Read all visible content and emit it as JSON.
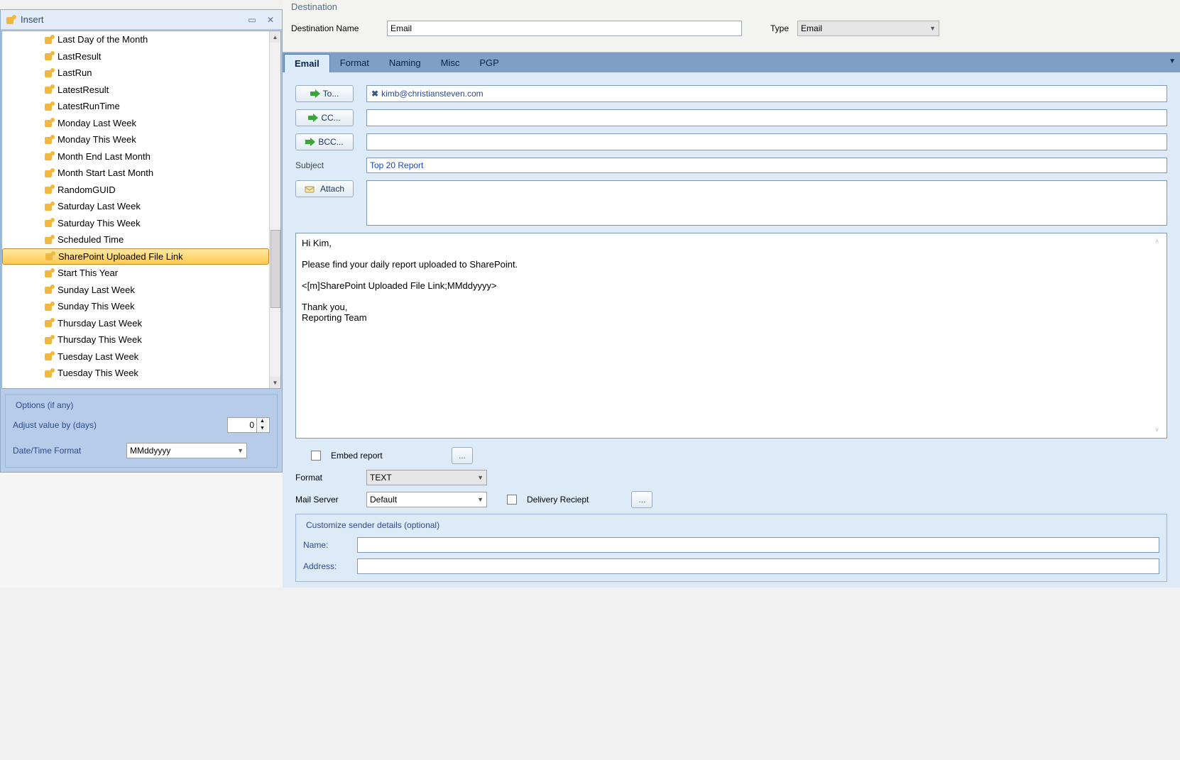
{
  "insert": {
    "title": "Insert",
    "items": [
      "Last Day of the Month",
      "LastResult",
      "LastRun",
      "LatestResult",
      "LatestRunTime",
      "Monday Last Week",
      "Monday This Week",
      "Month End Last Month",
      "Month Start Last Month",
      "RandomGUID",
      "Saturday Last Week",
      "Saturday This Week",
      "Scheduled Time",
      "SharePoint Uploaded File Link",
      "Start This Year",
      "Sunday Last Week",
      "Sunday This Week",
      "Thursday Last Week",
      "Thursday This Week",
      "Tuesday Last Week",
      "Tuesday This Week"
    ],
    "selected_index": 13,
    "options_title": "Options (if any)",
    "adjust_label": "Adjust value by (days)",
    "adjust_value": "0",
    "format_label": "Date/Time Format",
    "format_value": "MMddyyyy"
  },
  "destination": {
    "group_title": "Destination",
    "name_label": "Destination Name",
    "name_value": "Email",
    "type_label": "Type",
    "type_value": "Email",
    "tabs": [
      "Email",
      "Format",
      "Naming",
      "Misc",
      "PGP"
    ],
    "active_tab_index": 0
  },
  "email": {
    "to_label": "To...",
    "to_value": "kimb@christiansteven.com",
    "cc_label": "CC...",
    "cc_value": "",
    "bcc_label": "BCC...",
    "bcc_value": "",
    "subject_label": "Subject",
    "subject_value": "Top 20 Report",
    "attach_label": "Attach",
    "body": "Hi Kim,\n\nPlease find your daily report uploaded to SharePoint.\n\n<[m]SharePoint Uploaded File Link;MMddyyyy>\n\nThank you,\nReporting Team",
    "embed_label": "Embed report",
    "format_label": "Format",
    "format_value": "TEXT",
    "mail_server_label": "Mail Server",
    "mail_server_value": "Default",
    "delivery_label": "Delivery Reciept",
    "sender_title": "Customize sender details (optional)",
    "sender_name_label": "Name:",
    "sender_name_value": "",
    "sender_addr_label": "Address:",
    "sender_addr_value": ""
  }
}
